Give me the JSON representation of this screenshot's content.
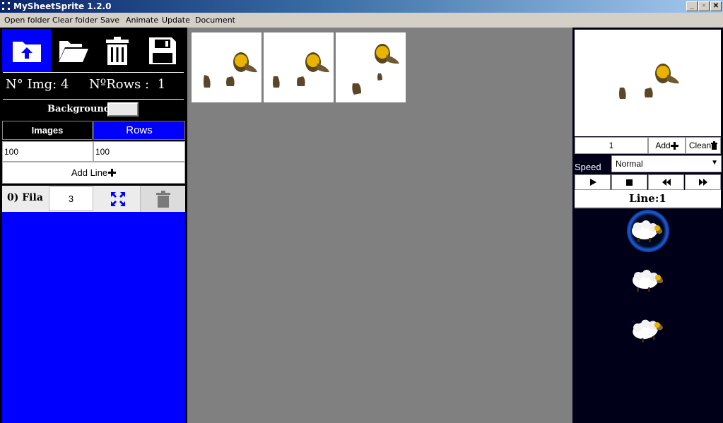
{
  "window": {
    "title": "MySheetSprite 1.2.0",
    "controls": [
      "_",
      "▫",
      "✕"
    ]
  },
  "menu": {
    "items": [
      "Open folder",
      "Clear folder",
      "Save",
      "Animate",
      "Update",
      "Document"
    ]
  },
  "left_panel": {
    "toolbar": [
      "upload-icon",
      "folder-open-icon",
      "trash-icon",
      "floppy-icon"
    ],
    "img_count_label": "N° Img:",
    "img_count_value": "4",
    "rows_count_label": "NºRows :",
    "rows_count_value": "1",
    "background_label": "Background",
    "tabs": {
      "images": "Images",
      "rows": "Rows"
    },
    "inputs": {
      "images_value": "100",
      "rows_value": "100"
    },
    "add_line_label": "Add Line",
    "fila_row": {
      "label": "0) Fila",
      "count": "3"
    }
  },
  "canvas": {
    "frames": [
      "frame-1",
      "frame-2",
      "frame-3"
    ]
  },
  "right_panel": {
    "frame_value": "1",
    "add_label": "Add",
    "clean_label": "Clean",
    "speed_label": "Speed",
    "speed_value": "Normal",
    "line_label": "Line:1",
    "animation_list": [
      "sheep-1",
      "sheep-2",
      "sheep-3"
    ]
  },
  "colors": {
    "accent_blue": "#0000ff",
    "panel_bg": "#000000",
    "canvas_bg": "#808080",
    "right_bg": "#000018"
  }
}
